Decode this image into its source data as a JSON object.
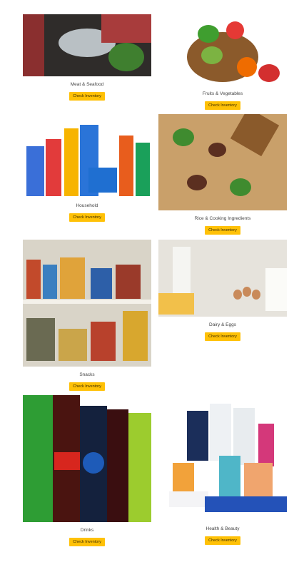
{
  "categories": [
    {
      "title": "Meat & Seafood",
      "button": "Check Inventory",
      "image": "meat-seafood-photo"
    },
    {
      "title": "Fruits & Vegetables",
      "button": "Check Inventory",
      "image": "fruit-basket-photo"
    },
    {
      "title": "Household",
      "button": "Check Inventory",
      "image": "cleaning-products-photo"
    },
    {
      "title": "Rice & Cooking Ingredients",
      "button": "Check Inventory",
      "image": "fried-rice-photo"
    },
    {
      "title": "Snacks",
      "button": "Check Inventory",
      "image": "pantry-shelves-photo"
    },
    {
      "title": "Dairy & Eggs",
      "button": "Check Inventory",
      "image": "dairy-eggs-photo"
    },
    {
      "title": "Drinks",
      "button": "Check Inventory",
      "image": "soda-bottles-photo"
    },
    {
      "title": "Health & Beauty",
      "button": "Check Inventory",
      "image": "toiletries-photo"
    }
  ]
}
